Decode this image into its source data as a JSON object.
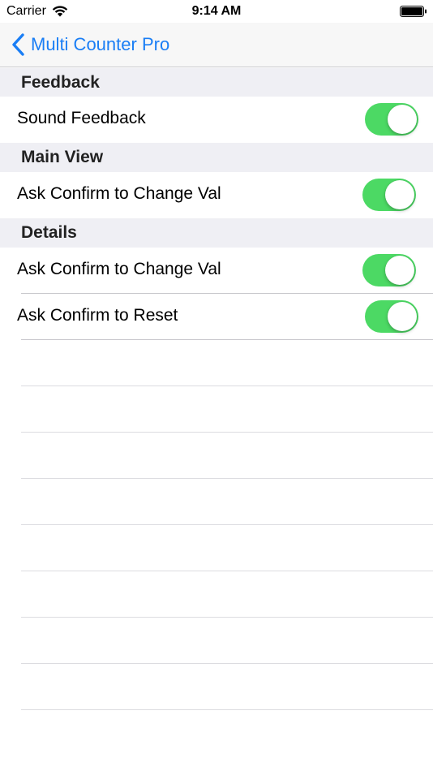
{
  "status_bar": {
    "carrier": "Carrier",
    "time": "9:14 AM",
    "wifi_icon": "wifi-icon",
    "battery_icon": "battery-icon"
  },
  "nav": {
    "back_label": "Multi Counter Pro",
    "back_icon": "chevron-left-icon"
  },
  "sections": [
    {
      "title": "Feedback",
      "rows": [
        {
          "label": "Sound Feedback",
          "on": true
        }
      ]
    },
    {
      "title": "Main View",
      "rows": [
        {
          "label": "Ask Confirm to Change Val",
          "on": true
        }
      ]
    },
    {
      "title": "Details",
      "rows": [
        {
          "label": "Ask Confirm to Change Val",
          "on": true
        },
        {
          "label": "Ask Confirm to Reset",
          "on": true
        }
      ]
    }
  ],
  "colors": {
    "accent": "#1a7ef5",
    "toggle_on": "#4cd964",
    "section_bg": "#efeff4",
    "separator": "#c8c7cc"
  }
}
